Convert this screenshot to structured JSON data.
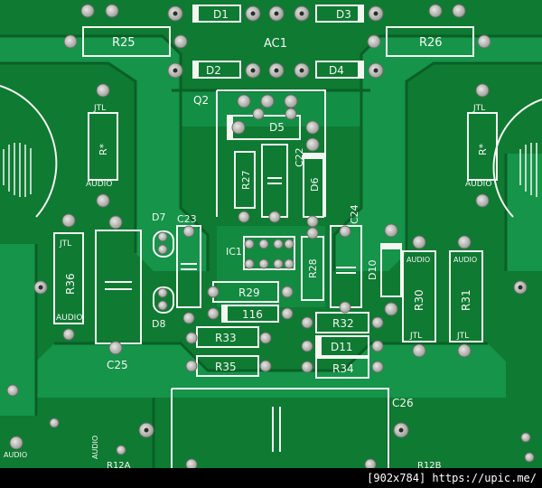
{
  "labels": {
    "d1": "D1",
    "d2": "D2",
    "d3": "D3",
    "d4": "D4",
    "d5": "D5",
    "d6": "D6",
    "d7": "D7",
    "d8": "D8",
    "d10": "D10",
    "d11": "D11",
    "ac1": "AC1",
    "q2": "Q2",
    "r25": "R25",
    "r26": "R26",
    "r27": "R27",
    "r28": "R28",
    "r29": "R29",
    "r30": "R30",
    "r31": "R31",
    "r32": "R32",
    "r33": "R33",
    "r34": "R34",
    "r35": "R35",
    "r36": "R36",
    "rstar": "R*",
    "c22": "C22",
    "c23": "C23",
    "c24": "C24",
    "c25": "C25",
    "c26": "C26",
    "ic1": "IC1",
    "v116": "116",
    "jtl": "JTL",
    "audio": "AUDIO",
    "r12a": "R12A",
    "r12b": "R12B"
  },
  "footer": {
    "caption": "[902x784] https://upic.me/"
  },
  "colors": {
    "board": "#0e7a32",
    "trace": "#149443",
    "silk": "#f4f6f2",
    "pad": "#c9c9c4"
  }
}
